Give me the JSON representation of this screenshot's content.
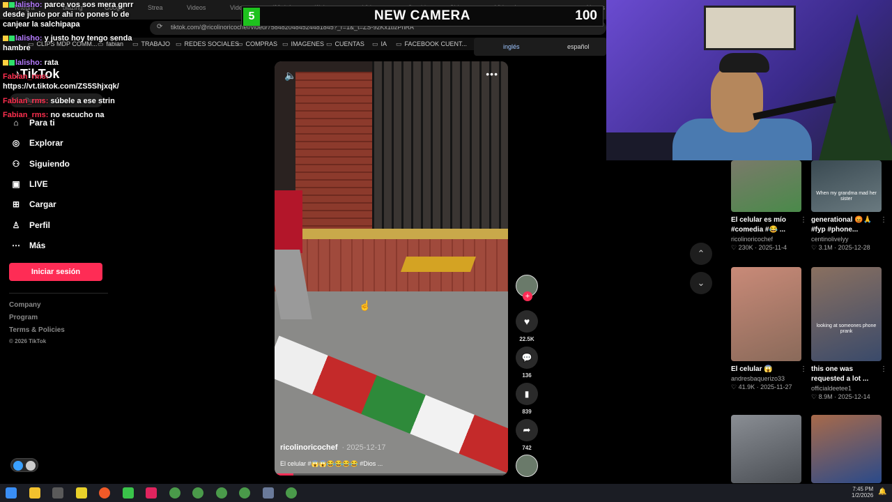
{
  "browser": {
    "tabs": [
      "Telegra",
      "blazing",
      "Google",
      "Strea",
      "Videos",
      "Video",
      "(99+) An",
      "(6) Insta",
      "Video",
      "Cambi",
      "Chistes",
      "Video d",
      "",
      "AI mes"
    ],
    "url": "tiktok.com/@ricolinoricochef/video/7584820484524481845?_r=1&_t=ZS-92Kx1bzPhRA",
    "bookmarks": [
      "CLIPS MDP COMM...",
      "fabian",
      "TRABAJO",
      "REDES SOCIALES",
      "COMPRAS",
      "IMAGENES",
      "CUENTAS",
      "IA",
      "FACEBOOK CUENT..."
    ]
  },
  "overlay": {
    "counter_left": "5",
    "title": "NEW CAMERA",
    "counter_right": "100",
    "lang_active": "inglés",
    "lang_other": "español"
  },
  "chat": [
    {
      "user": "lalisho",
      "color": "purple",
      "text": "parce vos sos mera gnrr desde junio por ahi no pones lo de canjear la salchipapa"
    },
    {
      "user": "lalisho",
      "color": "purple",
      "text": "y justo hoy tengo senda hambre"
    },
    {
      "user": "lalisho",
      "color": "purple",
      "text": "rata"
    },
    {
      "user": "Fabian_rms",
      "color": "red",
      "text": "https://vt.tiktok.com/ZS5Shjxqk/"
    },
    {
      "user": "Fabian_rms",
      "color": "red",
      "text": "súbele a ese strin"
    },
    {
      "user": "Fabian_rms",
      "color": "red",
      "text": "no escucho na"
    }
  ],
  "sidebar": {
    "logo": "TikTok",
    "search_placeholder": "Buscar",
    "items": [
      {
        "label": "Para ti",
        "icon": "home-icon"
      },
      {
        "label": "Explorar",
        "icon": "compass-icon"
      },
      {
        "label": "Siguiendo",
        "icon": "following-icon"
      },
      {
        "label": "LIVE",
        "icon": "live-icon"
      },
      {
        "label": "Cargar",
        "icon": "upload-icon"
      },
      {
        "label": "Perfil",
        "icon": "profile-icon"
      },
      {
        "label": "Más",
        "icon": "more-icon"
      }
    ],
    "login_label": "Iniciar sesión",
    "footer": [
      "Company",
      "Program",
      "Terms & Policies"
    ],
    "copyright": "© 2026 TikTok"
  },
  "video": {
    "author": "ricolinoricochef",
    "date": "· 2025-12-17",
    "caption": "El celular #😱😱😂😂😂😂 #Dios ...",
    "progress": 0.08,
    "likes": "22.5K",
    "comments": "136",
    "saves": "839",
    "shares": "742"
  },
  "recommended": [
    {
      "title": "El celular es mío #comedia #😂 ...",
      "user": "ricolinoricochef",
      "likes": "230K",
      "date": "2025-11-4",
      "colors": [
        "#7a7a6a",
        "#4a8a4a"
      ]
    },
    {
      "title": "generational 😡🙏 #fyp #phone...",
      "user": "centinolivelyy",
      "likes": "3.1M",
      "date": "2025-12-28",
      "colors": [
        "#3a4a52",
        "#6a7a80"
      ],
      "overlay": "When my grandma mad her sister"
    },
    {
      "title": "El celular 😱",
      "user": "andresbaquerizo33",
      "likes": "41.9K",
      "date": "2025-11-27",
      "colors": [
        "#c98a78",
        "#8a6a5a"
      ]
    },
    {
      "title": "this one was requested a lot ...",
      "user": "officialdeetee1",
      "likes": "8.9M",
      "date": "2025-12-14",
      "colors": [
        "#8a7060",
        "#3a4a6a"
      ],
      "overlay": "looking at someones phone prank"
    },
    {
      "title": "",
      "user": "",
      "likes": "",
      "date": "",
      "colors": [
        "#8a8e94",
        "#4a4e54"
      ]
    },
    {
      "title": "",
      "user": "",
      "likes": "",
      "date": "",
      "colors": [
        "#a86a4a",
        "#2a4a8a"
      ]
    }
  ],
  "taskbar": {
    "time": "7:45 PM",
    "date": "1/2/2026"
  }
}
